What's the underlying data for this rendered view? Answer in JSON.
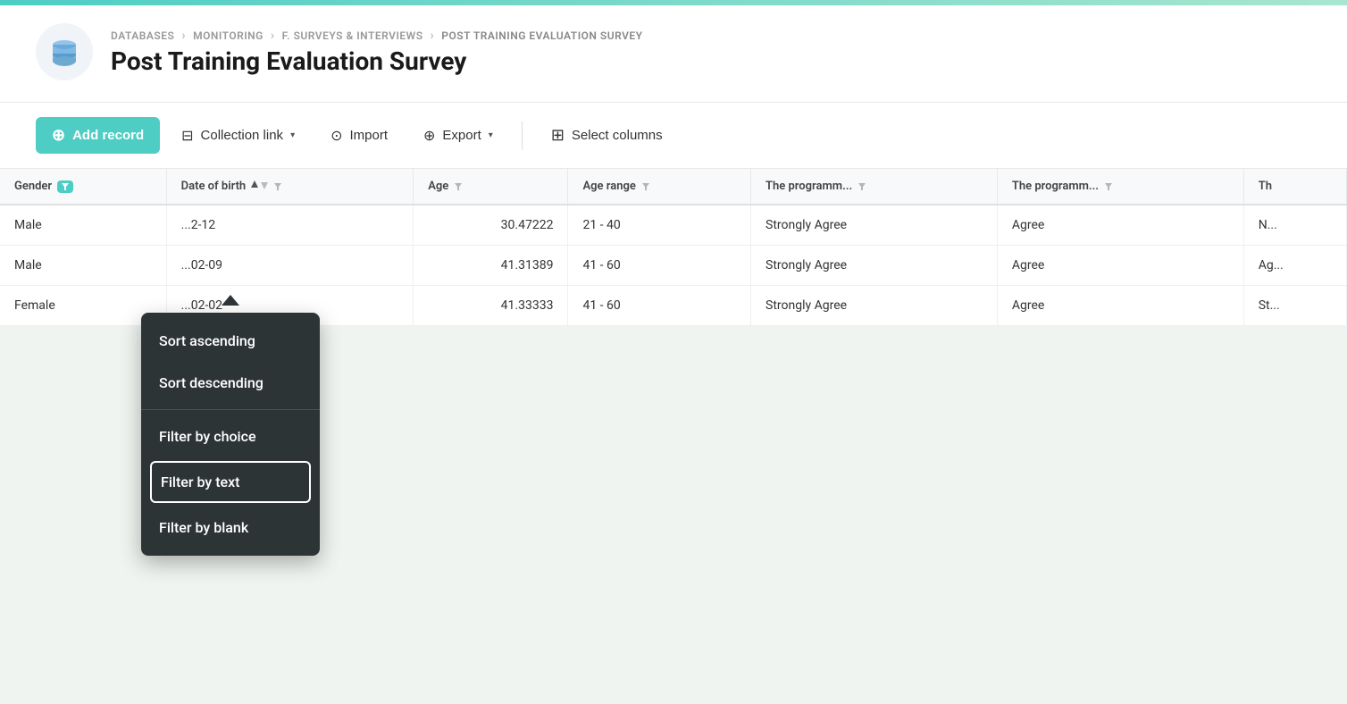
{
  "topbar": {},
  "header": {
    "breadcrumb": {
      "items": [
        "DATABASES",
        "MONITORING",
        "F. SURVEYS & INTERVIEWS",
        "POST TRAINING EVALUATION SURVEY"
      ]
    },
    "title": "Post Training Evaluation Survey"
  },
  "toolbar": {
    "add_record_label": "Add record",
    "collection_link_label": "Collection link",
    "import_label": "Import",
    "export_label": "Export",
    "select_columns_label": "Select columns"
  },
  "table": {
    "columns": [
      {
        "id": "gender",
        "label": "Gender",
        "has_sort": false,
        "has_filter": true,
        "filter_active": true
      },
      {
        "id": "dob",
        "label": "Date of birth",
        "has_sort": true,
        "has_filter": true,
        "filter_active": false
      },
      {
        "id": "age",
        "label": "Age",
        "has_sort": false,
        "has_filter": true,
        "filter_active": false
      },
      {
        "id": "age_range",
        "label": "Age range",
        "has_sort": false,
        "has_filter": true,
        "filter_active": false
      },
      {
        "id": "prog1",
        "label": "The programm...",
        "has_sort": false,
        "has_filter": true,
        "filter_active": false
      },
      {
        "id": "prog2",
        "label": "The programm...",
        "has_sort": false,
        "has_filter": true,
        "filter_active": false
      },
      {
        "id": "prog3",
        "label": "Th",
        "has_sort": false,
        "has_filter": false,
        "filter_active": false
      }
    ],
    "rows": [
      {
        "gender": "Male",
        "dob": "...2-12",
        "age": "30.47222",
        "age_range": "21 - 40",
        "prog1": "Strongly Agree",
        "prog2": "Agree",
        "prog3": "N..."
      },
      {
        "gender": "Male",
        "dob": "...02-09",
        "age": "41.31389",
        "age_range": "41 - 60",
        "prog1": "Strongly Agree",
        "prog2": "Agree",
        "prog3": "Ag..."
      },
      {
        "gender": "Female",
        "dob": "...02-02",
        "age": "41.33333",
        "age_range": "41 - 60",
        "prog1": "Strongly Agree",
        "prog2": "Agree",
        "prog3": "St..."
      }
    ]
  },
  "dropdown": {
    "items": [
      {
        "id": "sort-asc",
        "label": "Sort ascending",
        "active": false,
        "divider_after": false
      },
      {
        "id": "sort-desc",
        "label": "Sort descending",
        "active": false,
        "divider_after": true
      },
      {
        "id": "filter-choice",
        "label": "Filter by choice",
        "active": false,
        "divider_after": false
      },
      {
        "id": "filter-text",
        "label": "Filter by text",
        "active": true,
        "divider_after": false
      },
      {
        "id": "filter-blank",
        "label": "Filter by blank",
        "active": false,
        "divider_after": false
      }
    ]
  }
}
